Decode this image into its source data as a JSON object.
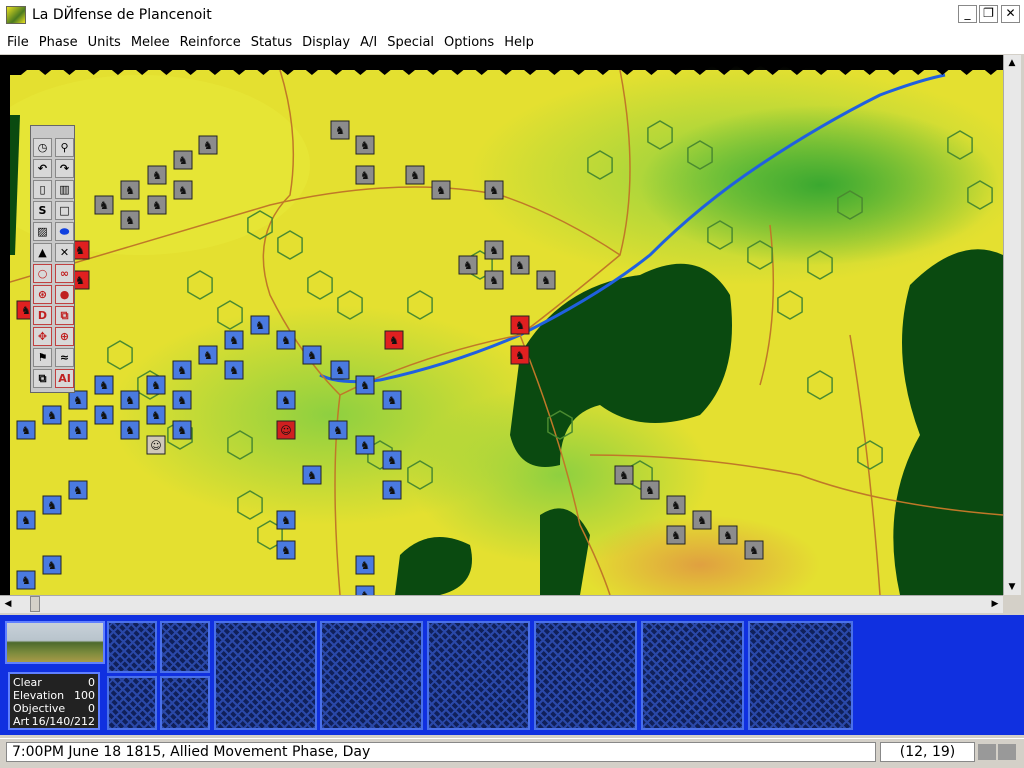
{
  "window": {
    "title": "La DЙfense de Plancenoit",
    "minimize": "_",
    "restore": "❐",
    "close": "✕"
  },
  "menu": [
    "File",
    "Phase",
    "Units",
    "Melee",
    "Reinforce",
    "Status",
    "Display",
    "A/I",
    "Special",
    "Options",
    "Help"
  ],
  "toolbar": {
    "buttons": [
      "clock-icon",
      "magnify-icon",
      "rotate-left-icon",
      "rotate-right-icon",
      "exit-unit-icon",
      "formation-icon",
      "s-icon",
      "square-icon",
      "map-icon",
      "blue-oval-icon",
      "artillery-pile-icon",
      "crossed-muskets-icon",
      "circle-icon",
      "binoculars-icon",
      "wheel-icon",
      "cannonball-icon",
      "d-icon",
      "stack-icon",
      "move-arrows-icon",
      "target-icon",
      "flag-icon",
      "map-route-icon",
      "combine-icon",
      "ai-icon"
    ],
    "d_label": "D",
    "ai_label": "AI",
    "s_label": "S"
  },
  "terrain": {
    "rows": [
      {
        "label": "Clear",
        "value": "0"
      },
      {
        "label": "Elevation",
        "value": "100"
      },
      {
        "label": "Objective",
        "value": "0"
      },
      {
        "label": "Art",
        "value": "16/140/212"
      }
    ]
  },
  "status": {
    "message": "7:00PM June 18 1815, Allied Movement Phase, Day",
    "coords": "(12, 19)"
  },
  "colors": {
    "french": "#e02020",
    "allied": "#4a7ae0",
    "neutral": "#909090",
    "river": "#2060e0",
    "panel": "#1030e0"
  }
}
